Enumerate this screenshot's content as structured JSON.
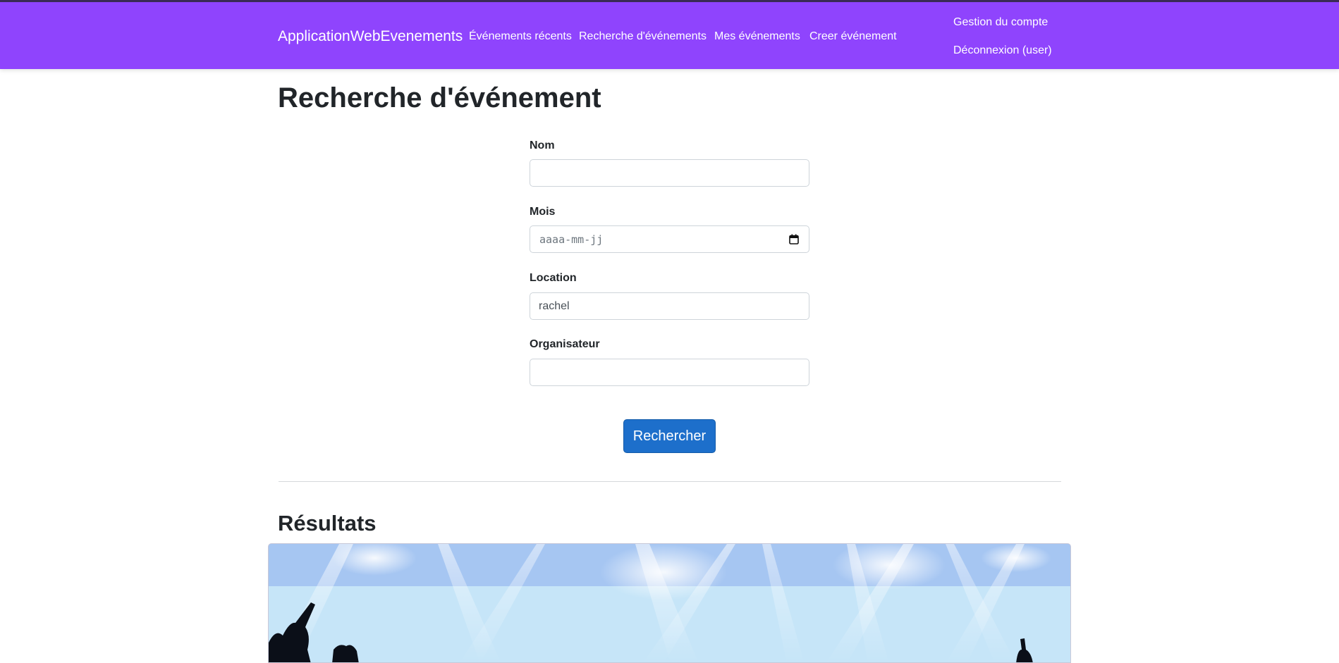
{
  "navbar": {
    "brand": "ApplicationWebEvenements",
    "links": [
      {
        "label": "Événements récents"
      },
      {
        "label": "Recherche d'événements"
      },
      {
        "label": "Mes événements"
      },
      {
        "label": "Creer événement"
      }
    ],
    "account": "Gestion du compte",
    "logout": "Déconnexion (user)",
    "background_color": "#8f44fd"
  },
  "page": {
    "title": "Recherche d'événement"
  },
  "form": {
    "nom": {
      "label": "Nom",
      "value": ""
    },
    "mois": {
      "label": "Mois",
      "placeholder": "aaaa-mm-jj",
      "icon": "calendar-icon"
    },
    "location": {
      "label": "Location",
      "value": "rachel"
    },
    "organisateur": {
      "label": "Organisateur",
      "value": ""
    },
    "submit_label": "Rechercher",
    "submit_color": "#1d6fcb"
  },
  "results": {
    "title": "Résultats",
    "cards": [
      {
        "image": "concert-crowd-stage-lights"
      }
    ]
  }
}
